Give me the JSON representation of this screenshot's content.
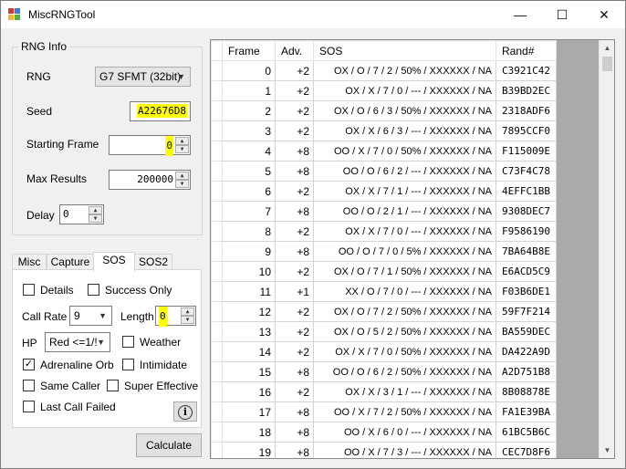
{
  "window": {
    "title": "MiscRNGTool",
    "minimize": "—",
    "maximize": "☐",
    "close": "✕"
  },
  "rng_info": {
    "legend": "RNG Info",
    "rng_label": "RNG",
    "rng_value": "G7 SFMT (32bit)",
    "seed_label": "Seed",
    "seed_value": "A22676D8",
    "start_label": "Starting Frame",
    "start_value": "0",
    "max_label": "Max Results",
    "max_value": "200000",
    "delay_label": "Delay",
    "delay_value": "0"
  },
  "tabs": [
    "Misc",
    "Capture",
    "SOS",
    "SOS2"
  ],
  "active_tab": "SOS",
  "sos": {
    "details": "Details",
    "success_only": "Success Only",
    "call_rate_label": "Call Rate",
    "call_rate_value": "9",
    "length_label": "Length",
    "length_value": "0",
    "hp_label": "HP",
    "hp_value": "Red <=1/!",
    "weather": "Weather",
    "adrenaline": "Adrenaline Orb",
    "adrenaline_checked": true,
    "intimidate": "Intimidate",
    "same_caller": "Same Caller",
    "super_effective": "Super Effective",
    "last_call_failed": "Last Call Failed",
    "info_icon": "i"
  },
  "calculate": "Calculate",
  "table": {
    "headers": [
      "Frame",
      "Adv.",
      "SOS",
      "Rand#"
    ],
    "rows": [
      [
        "0",
        "+2",
        "OX / O / 7 / 2 / 50% / XXXXXX / NA",
        "C3921C42"
      ],
      [
        "1",
        "+2",
        "OX / X / 7 / 0 / --- / XXXXXX / NA",
        "B39BD2EC"
      ],
      [
        "2",
        "+2",
        "OX / O / 6 / 3 / 50% / XXXXXX / NA",
        "2318ADF6"
      ],
      [
        "3",
        "+2",
        "OX / X / 6 / 3 / --- / XXXXXX / NA",
        "7895CCF0"
      ],
      [
        "4",
        "+8",
        "OO / X / 7 / 0 / 50% / XXXXXX / NA",
        "F115009E"
      ],
      [
        "5",
        "+8",
        "OO / O / 6 / 2 / --- / XXXXXX / NA",
        "C73F4C78"
      ],
      [
        "6",
        "+2",
        "OX / X / 7 / 1 / --- / XXXXXX / NA",
        "4EFFC1BB"
      ],
      [
        "7",
        "+8",
        "OO / O / 2 / 1 / --- / XXXXXX / NA",
        "9308DEC7"
      ],
      [
        "8",
        "+2",
        "OX / X / 7 / 0 / --- / XXXXXX / NA",
        "F9586190"
      ],
      [
        "9",
        "+8",
        "OO / O / 7 / 0 / 5% / XXXXXX / NA",
        "7BA64B8E"
      ],
      [
        "10",
        "+2",
        "OX / O / 7 / 1 / 50% / XXXXXX / NA",
        "E6ACD5C9"
      ],
      [
        "11",
        "+1",
        "XX / O / 7 / 0 / --- / XXXXXX / NA",
        "F03B6DE1"
      ],
      [
        "12",
        "+2",
        "OX / O / 7 / 2 / 50% / XXXXXX / NA",
        "59F7F214"
      ],
      [
        "13",
        "+2",
        "OX / O / 5 / 2 / 50% / XXXXXX / NA",
        "BA559DEC"
      ],
      [
        "14",
        "+2",
        "OX / X / 7 / 0 / 50% / XXXXXX / NA",
        "DA422A9D"
      ],
      [
        "15",
        "+8",
        "OO / O / 6 / 2 / 50% / XXXXXX / NA",
        "A2D751B8"
      ],
      [
        "16",
        "+2",
        "OX / X / 3 / 1 / --- / XXXXXX / NA",
        "8B08878E"
      ],
      [
        "17",
        "+8",
        "OO / X / 7 / 2 / 50% / XXXXXX / NA",
        "FA1E39BA"
      ],
      [
        "18",
        "+8",
        "OO / X / 6 / 0 / --- / XXXXXX / NA",
        "61BC5B6C"
      ],
      [
        "19",
        "+8",
        "OO / X / 7 / 3 / --- / XXXXXX / NA",
        "CEC7D8F6"
      ]
    ]
  }
}
